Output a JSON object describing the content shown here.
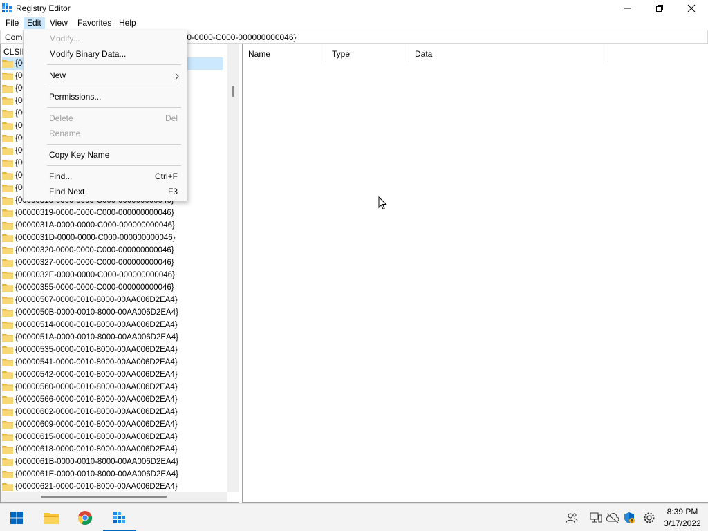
{
  "window": {
    "title": "Registry Editor"
  },
  "menubar": {
    "items": [
      "File",
      "Edit",
      "View",
      "Favorites",
      "Help"
    ]
  },
  "address": {
    "value": "Com                                                              F-0000-0000-C000-000000000046}"
  },
  "tree": {
    "root_label": "CLSID",
    "items": [
      "{00",
      "{00",
      "{00",
      "{00",
      "{00",
      "{00",
      "{00",
      "{00",
      "{00",
      "{00",
      "{00",
      "{00000318-0000-0000-C000-000000000046}",
      "{00000319-0000-0000-C000-000000000046}",
      "{0000031A-0000-0000-C000-000000000046}",
      "{0000031D-0000-0000-C000-000000000046}",
      "{00000320-0000-0000-C000-000000000046}",
      "{00000327-0000-0000-C000-000000000046}",
      "{0000032E-0000-0000-C000-000000000046}",
      "{00000355-0000-0000-C000-000000000046}",
      "{00000507-0000-0010-8000-00AA006D2EA4}",
      "{0000050B-0000-0010-8000-00AA006D2EA4}",
      "{00000514-0000-0010-8000-00AA006D2EA4}",
      "{0000051A-0000-0010-8000-00AA006D2EA4}",
      "{00000535-0000-0010-8000-00AA006D2EA4}",
      "{00000541-0000-0010-8000-00AA006D2EA4}",
      "{00000542-0000-0010-8000-00AA006D2EA4}",
      "{00000560-0000-0010-8000-00AA006D2EA4}",
      "{00000566-0000-0010-8000-00AA006D2EA4}",
      "{00000602-0000-0010-8000-00AA006D2EA4}",
      "{00000609-0000-0010-8000-00AA006D2EA4}",
      "{00000615-0000-0010-8000-00AA006D2EA4}",
      "{00000618-0000-0010-8000-00AA006D2EA4}",
      "{0000061B-0000-0010-8000-00AA006D2EA4}",
      "{0000061E-0000-0010-8000-00AA006D2EA4}",
      "{00000621-0000-0010-8000-00AA006D2EA4}"
    ]
  },
  "list": {
    "columns": [
      "Name",
      "Type",
      "Data"
    ]
  },
  "edit_menu": {
    "modify": "Modify...",
    "modify_binary": "Modify Binary Data...",
    "new": "New",
    "permissions": "Permissions...",
    "delete": "Delete",
    "delete_shortcut": "Del",
    "rename": "Rename",
    "copy_key_name": "Copy Key Name",
    "find": "Find...",
    "find_shortcut": "Ctrl+F",
    "find_next": "Find Next",
    "find_next_shortcut": "F3"
  },
  "taskbar": {
    "time": "8:39 PM",
    "date": "3/17/2022"
  },
  "colors": {
    "accent": "#0067c0",
    "menu_highlight": "#cce8ff",
    "folder": "#f8d775",
    "disabled_text": "#a0a0a0"
  }
}
